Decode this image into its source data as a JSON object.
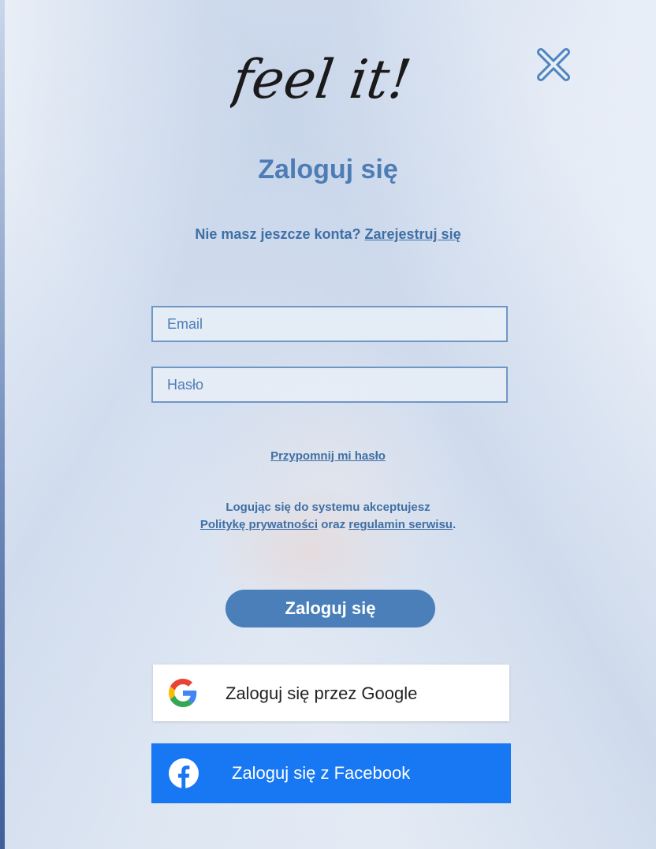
{
  "logo": {
    "text": "feel it!"
  },
  "close": {
    "icon": "close-x-icon"
  },
  "title": "Zaloguj się",
  "signup": {
    "prompt": "Nie masz jeszcze konta?",
    "link": "Zarejestruj się"
  },
  "fields": {
    "email": {
      "placeholder": "Email",
      "value": ""
    },
    "password": {
      "placeholder": "Hasło",
      "value": ""
    }
  },
  "remind_link": "Przypomnij mi hasło",
  "policy": {
    "line1": "Logując się do systemu akceptujesz",
    "privacy_link": "Politykę prywatności",
    "conjunction": "oraz",
    "terms_link": "regulamin serwisu",
    "end": "."
  },
  "buttons": {
    "login": "Zaloguj się",
    "google": {
      "label": "Zaloguj się przez Google",
      "icon": "google-icon"
    },
    "facebook": {
      "label": "Zaloguj się z Facebook",
      "icon": "facebook-icon"
    }
  },
  "colors": {
    "accent": "#4d7db4",
    "login_button": "#4a7fba",
    "facebook_blue": "#1877f2"
  }
}
